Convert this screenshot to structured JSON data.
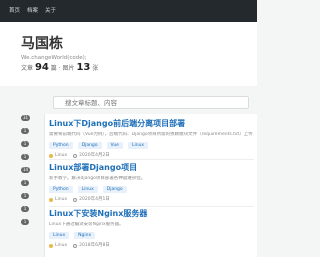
{
  "nav": {
    "items": [
      "首页",
      "档案",
      "关于"
    ]
  },
  "profile": {
    "name": "马国栋",
    "motto": "We.changeWorld(code);",
    "articles_label": "文章",
    "articles_count": "94",
    "separator": "篇 · 图片",
    "images_count": "13",
    "images_unit": "张"
  },
  "sidebar": {
    "badges": [
      "31",
      "1",
      "1",
      "1",
      "14",
      "1",
      "1",
      "1",
      "1"
    ]
  },
  "search": {
    "placeholder": "搜文章标题、内容"
  },
  "articles": [
    {
      "title": "Linux下Django前后端分离项目部署",
      "summary": "需要将前端代码（Vue为例），后端代码、Django项目所需的依赖模块文件（requirements.txt）上传",
      "tags": [
        "Python",
        "Django",
        "Vue",
        "Linux"
      ],
      "category": "Linux",
      "date": "2020年4月2日"
    },
    {
      "title": "Linux部署Django项目",
      "summary": "新手教学。解决django项目部署各种疑难杂症。",
      "tags": [
        "Python",
        "Linux",
        "Django"
      ],
      "category": "Linux",
      "date": "2020年4月1日"
    },
    {
      "title": "Linux下安装Nginx服务器",
      "summary": "Linux下通过编译安装Nginx服务器。",
      "tags": [
        "Linux",
        "Nginx"
      ],
      "category": "Linux",
      "date": "2018年6月8日"
    }
  ]
}
